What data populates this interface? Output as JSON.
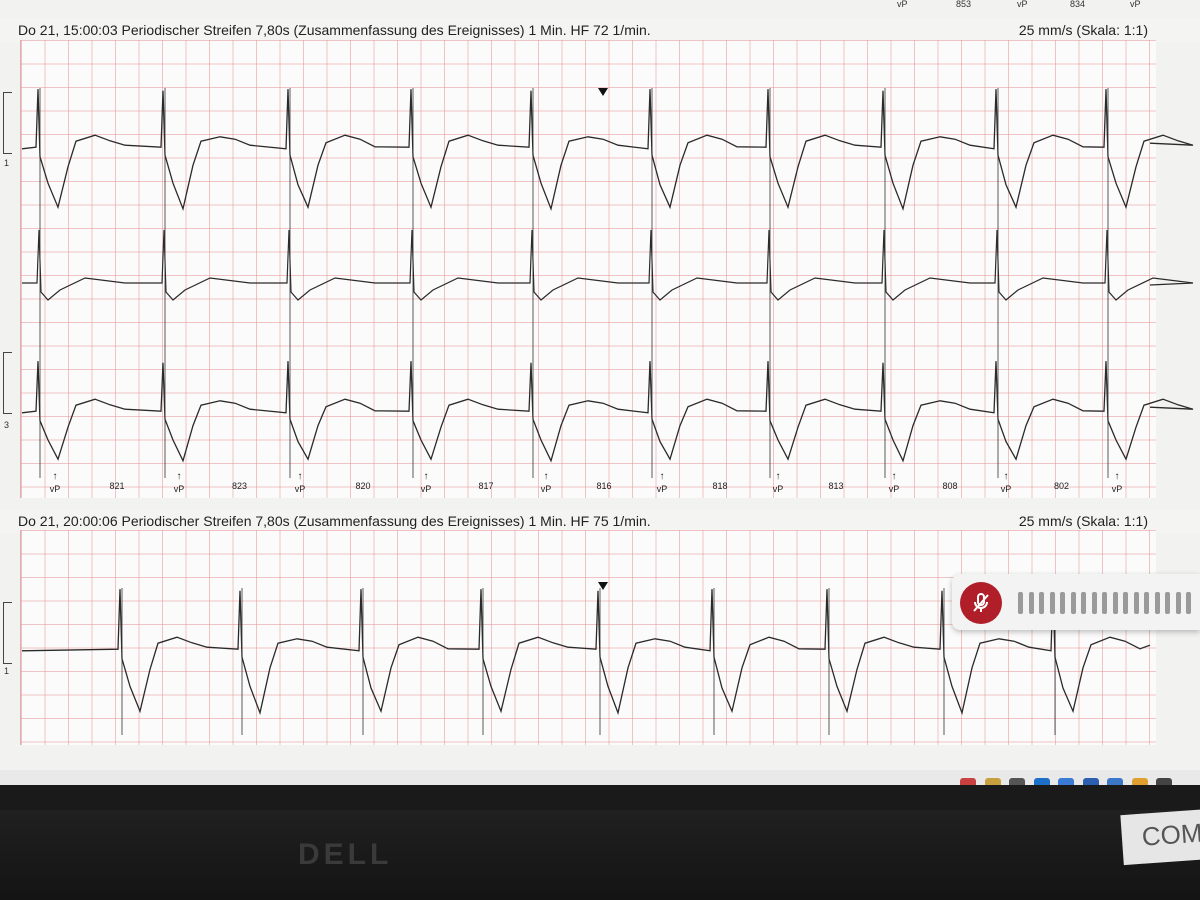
{
  "top_cutoff": {
    "labels": [
      "vP",
      "853",
      "vP",
      "834",
      "vP"
    ]
  },
  "strip1": {
    "title": "Do 21, 15:00:03 Periodischer Streifen 7,80s (Zusammenfassung des Ereignisses) 1 Min. HF 72 1/min.",
    "speed": "25 mm/s (Skala: 1:1)",
    "lead_labels": [
      "1",
      "3"
    ],
    "pace_marker_label": "vP",
    "rr_intervals": [
      "821",
      "823",
      "820",
      "817",
      "816",
      "818",
      "813",
      "808",
      "802"
    ]
  },
  "strip2": {
    "title": "Do 21, 20:00:06 Periodischer Streifen 7,80s (Zusammenfassung des Ereignisses) 1 Min. HF 75 1/min.",
    "speed": "25 mm/s (Skala: 1:1)",
    "lead_labels": [
      "1"
    ]
  },
  "mic_widget": {
    "icon": "mic-muted-icon",
    "level_bars": 17
  },
  "taskbar": {
    "tray_icons": [
      "network-icon",
      "user-icon",
      "battery-icon",
      "outlook-icon",
      "chrome-icon",
      "app-s-icon",
      "app-person-icon",
      "app-sticky-icon",
      "monitor-icon"
    ]
  },
  "bezel": {
    "brand": "DELL",
    "sticker_text": "COM"
  },
  "colors": {
    "grid": "#e89696",
    "trace": "#2a2a2a",
    "mic_button": "#b01e2a"
  }
}
